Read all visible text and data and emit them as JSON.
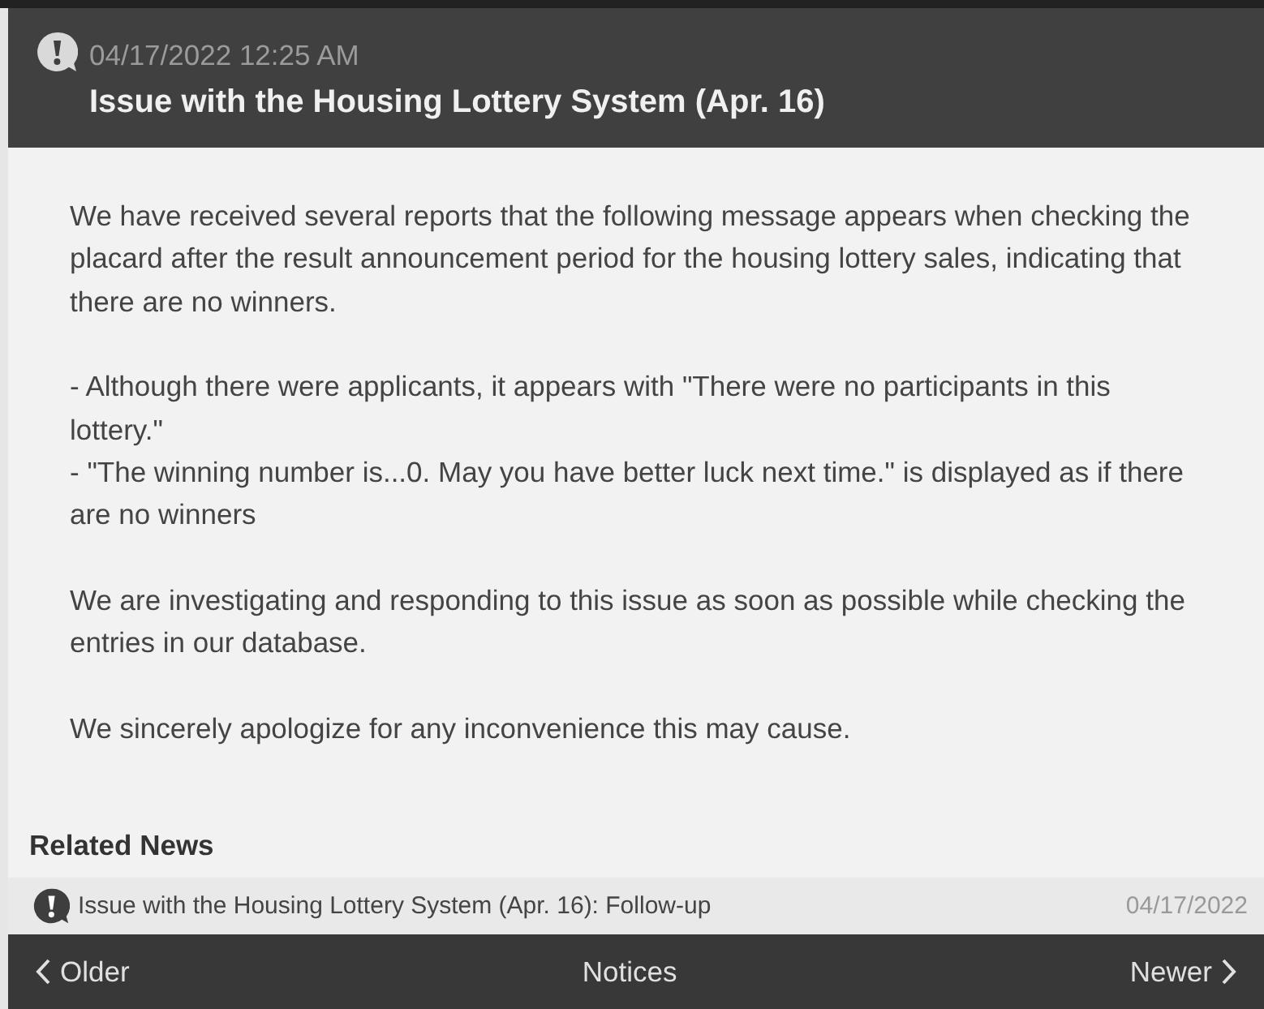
{
  "notice": {
    "date": "04/17/2022 12:25 AM",
    "title": "Issue with the Housing Lottery System (Apr. 16)"
  },
  "body": [
    {
      "kind": "text",
      "text": "We have received several reports that the following message appears when checking the placard after the result announcement period for the housing lottery sales, indicating that there are no winners."
    },
    {
      "kind": "list",
      "items": [
        "- Although there were applicants, it appears with \"There were no participants in this lottery.\"",
        "- \"The winning number is...0. May you have better luck next time.\" is displayed as if there are no winners"
      ]
    },
    {
      "kind": "text",
      "text": "We are investigating and responding to this issue as soon as possible while checking the entries in our database."
    },
    {
      "kind": "text",
      "text": "We sincerely apologize for any inconvenience this may cause."
    }
  ],
  "related_news": {
    "heading": "Related News",
    "items": [
      {
        "title": "Issue with the Housing Lottery System (Apr. 16): Follow-up",
        "date": "04/17/2022"
      }
    ]
  },
  "footer": {
    "older": "Older",
    "center": "Notices",
    "newer": "Newer"
  }
}
